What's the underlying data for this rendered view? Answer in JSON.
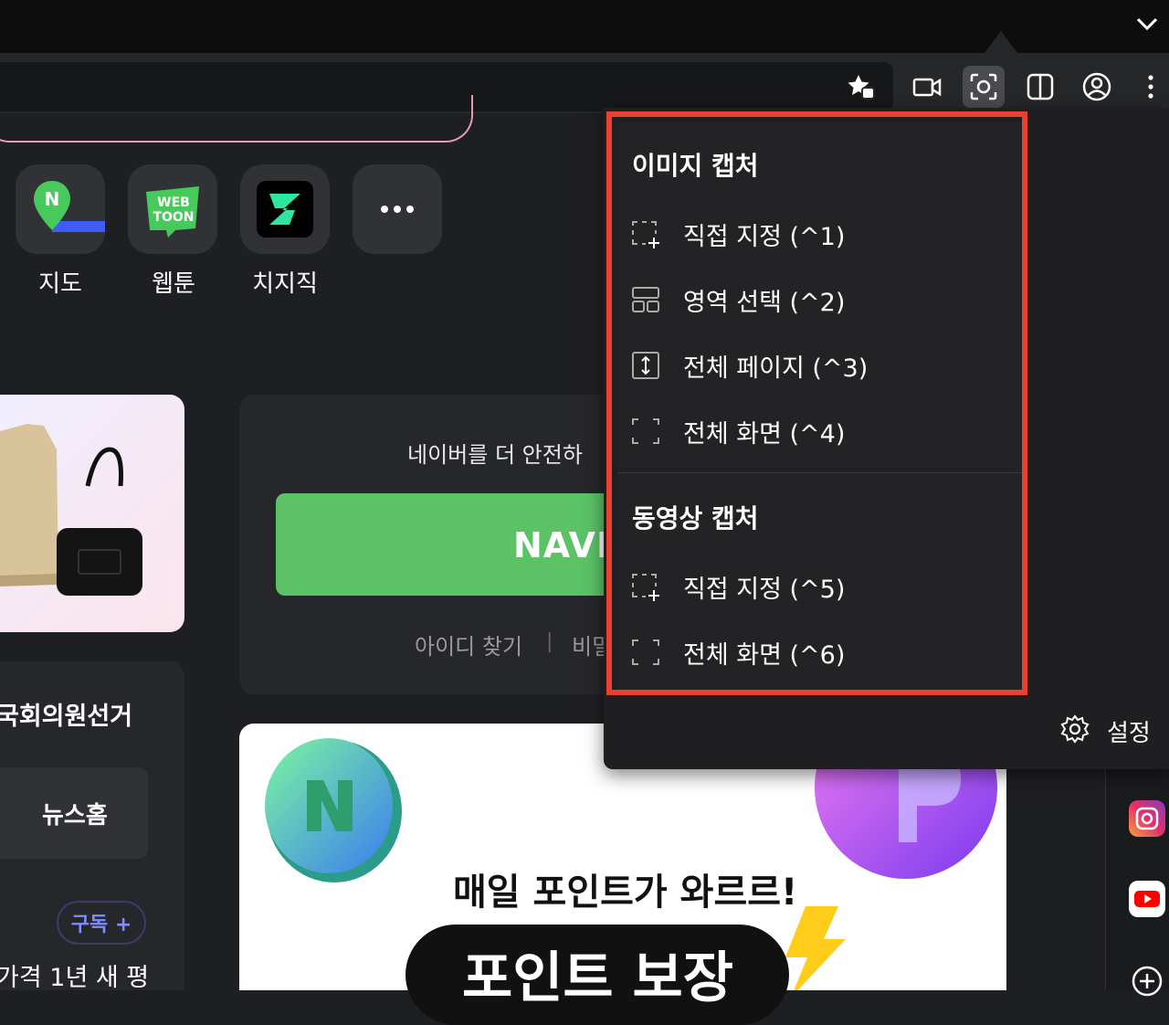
{
  "toolbar": {
    "icons": [
      "favorites-icon",
      "video-capture-icon",
      "screen-capture-icon",
      "split-view-icon",
      "profile-icon",
      "more-icon"
    ]
  },
  "apps": [
    {
      "label": "지도",
      "icon": "map-app-icon"
    },
    {
      "label": "웹툰",
      "icon": "webtoon-app-icon",
      "badge_top": "WEB",
      "badge_bottom": "TOON"
    },
    {
      "label": "치지직",
      "icon": "chzzk-app-icon"
    },
    {
      "label": "",
      "icon": "more-apps-icon"
    }
  ],
  "login": {
    "message": "네이버를 더 안전하",
    "button_label": "NAVE",
    "find_id": "아이디 찾기",
    "separator": "|",
    "find_pw": "비밀"
  },
  "news": {
    "election": "국회의원선거",
    "home_button": "뉴스홈",
    "subscribe": "구독 +",
    "headline": "가격 1년 새 평"
  },
  "promo": {
    "line1": "매일 포인트가 와르르!",
    "pill": "포인트 보장"
  },
  "capture_menu": {
    "image_section": "이미지 캡처",
    "image_items": [
      {
        "label": "직접 지정 (^1)",
        "icon": "custom-region-icon"
      },
      {
        "label": "영역 선택 (^2)",
        "icon": "area-select-icon"
      },
      {
        "label": "전체 페이지 (^3)",
        "icon": "full-page-icon"
      },
      {
        "label": "전체 화면 (^4)",
        "icon": "full-screen-icon"
      }
    ],
    "video_section": "동영상 캡처",
    "video_items": [
      {
        "label": "직접 지정 (^5)",
        "icon": "custom-region-icon"
      },
      {
        "label": "전체 화면 (^6)",
        "icon": "full-screen-icon"
      }
    ],
    "settings_label": "설정"
  },
  "colors": {
    "highlight": "#e8412f",
    "naver_green": "#5bc266",
    "subscribe_blue": "#7f8cff"
  }
}
